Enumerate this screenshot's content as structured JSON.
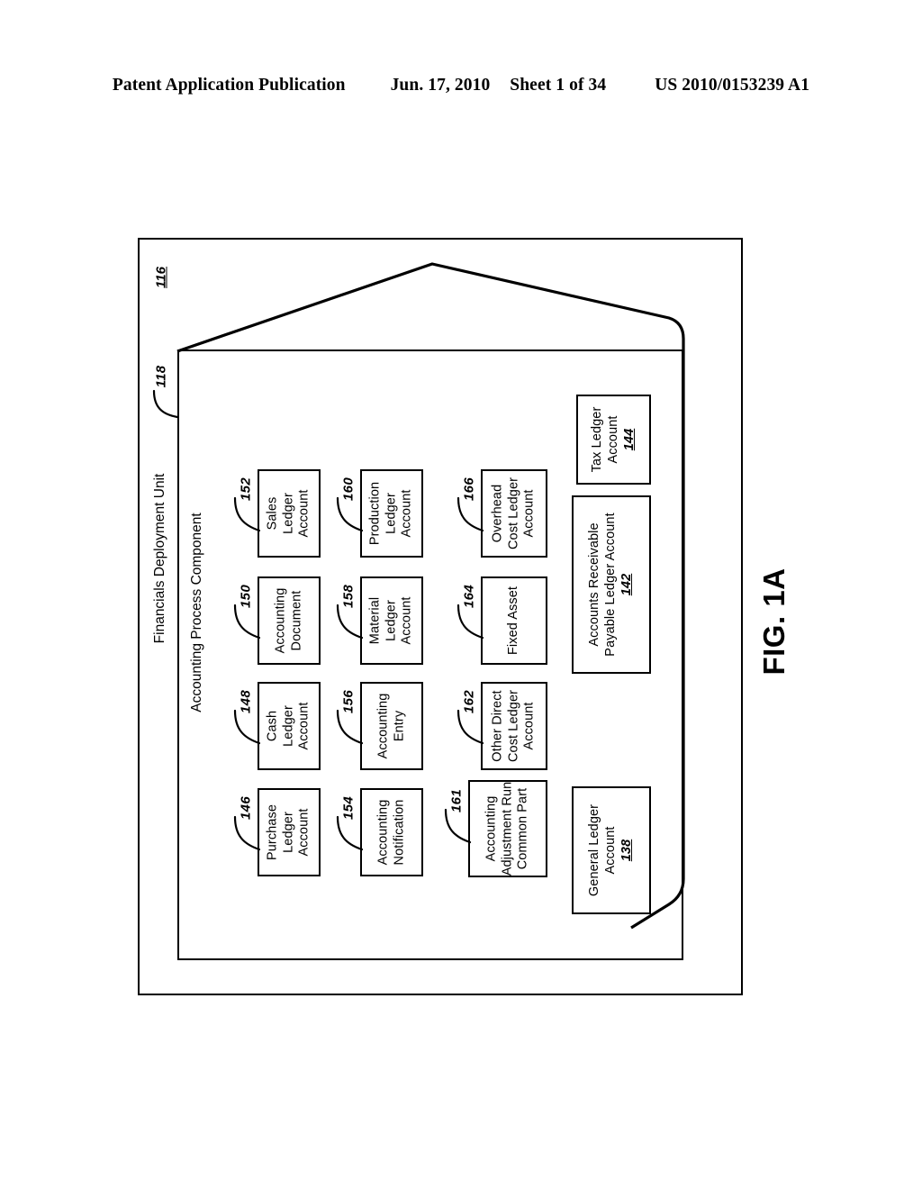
{
  "header": {
    "publication": "Patent Application Publication",
    "date": "Jun. 17, 2010",
    "sheet": "Sheet 1 of 34",
    "number": "US 2010/0153239 A1"
  },
  "figure": {
    "caption": "FIG. 1A",
    "deployment_unit": {
      "title": "Financials Deployment Unit",
      "ref": "116"
    },
    "process_component": {
      "title": "Accounting Process Component",
      "ref": "118"
    }
  },
  "components": [
    {
      "id": "purchase-ledger-account",
      "ref": "146",
      "lines": [
        "Purchase",
        "Ledger",
        "Account"
      ]
    },
    {
      "id": "cash-ledger-account",
      "ref": "148",
      "lines": [
        "Cash",
        "Ledger",
        "Account"
      ]
    },
    {
      "id": "accounting-document",
      "ref": "150",
      "lines": [
        "Accounting",
        "Document"
      ]
    },
    {
      "id": "sales-ledger-account",
      "ref": "152",
      "lines": [
        "Sales",
        "Ledger",
        "Account"
      ]
    },
    {
      "id": "accounting-notification",
      "ref": "154",
      "lines": [
        "Accounting",
        "Notification"
      ]
    },
    {
      "id": "accounting-entry",
      "ref": "156",
      "lines": [
        "Accounting",
        "Entry"
      ]
    },
    {
      "id": "material-ledger-account",
      "ref": "158",
      "lines": [
        "Material",
        "Ledger",
        "Account"
      ]
    },
    {
      "id": "production-ledger-account",
      "ref": "160",
      "lines": [
        "Production",
        "Ledger",
        "Account"
      ]
    },
    {
      "id": "accounting-adjustment-run",
      "ref": "161",
      "lines": [
        "Accounting",
        "Adjustment Run",
        "Common Part"
      ]
    },
    {
      "id": "other-direct-cost-ledger",
      "ref": "162",
      "lines": [
        "Other Direct",
        "Cost Ledger",
        "Account"
      ]
    },
    {
      "id": "fixed-asset",
      "ref": "164",
      "lines": [
        "Fixed Asset"
      ]
    },
    {
      "id": "overhead-cost-ledger-account",
      "ref": "166",
      "lines": [
        "Overhead",
        "Cost Ledger",
        "Account"
      ]
    },
    {
      "id": "general-ledger-account",
      "ref": "138",
      "lines": [
        "General Ledger",
        "Account"
      ]
    },
    {
      "id": "accounts-receivable-payable",
      "ref": "142",
      "lines": [
        "Accounts Receivable",
        "Payable Ledger Account"
      ]
    },
    {
      "id": "tax-ledger-account",
      "ref": "144",
      "lines": [
        "Tax Ledger",
        "Account"
      ]
    }
  ]
}
